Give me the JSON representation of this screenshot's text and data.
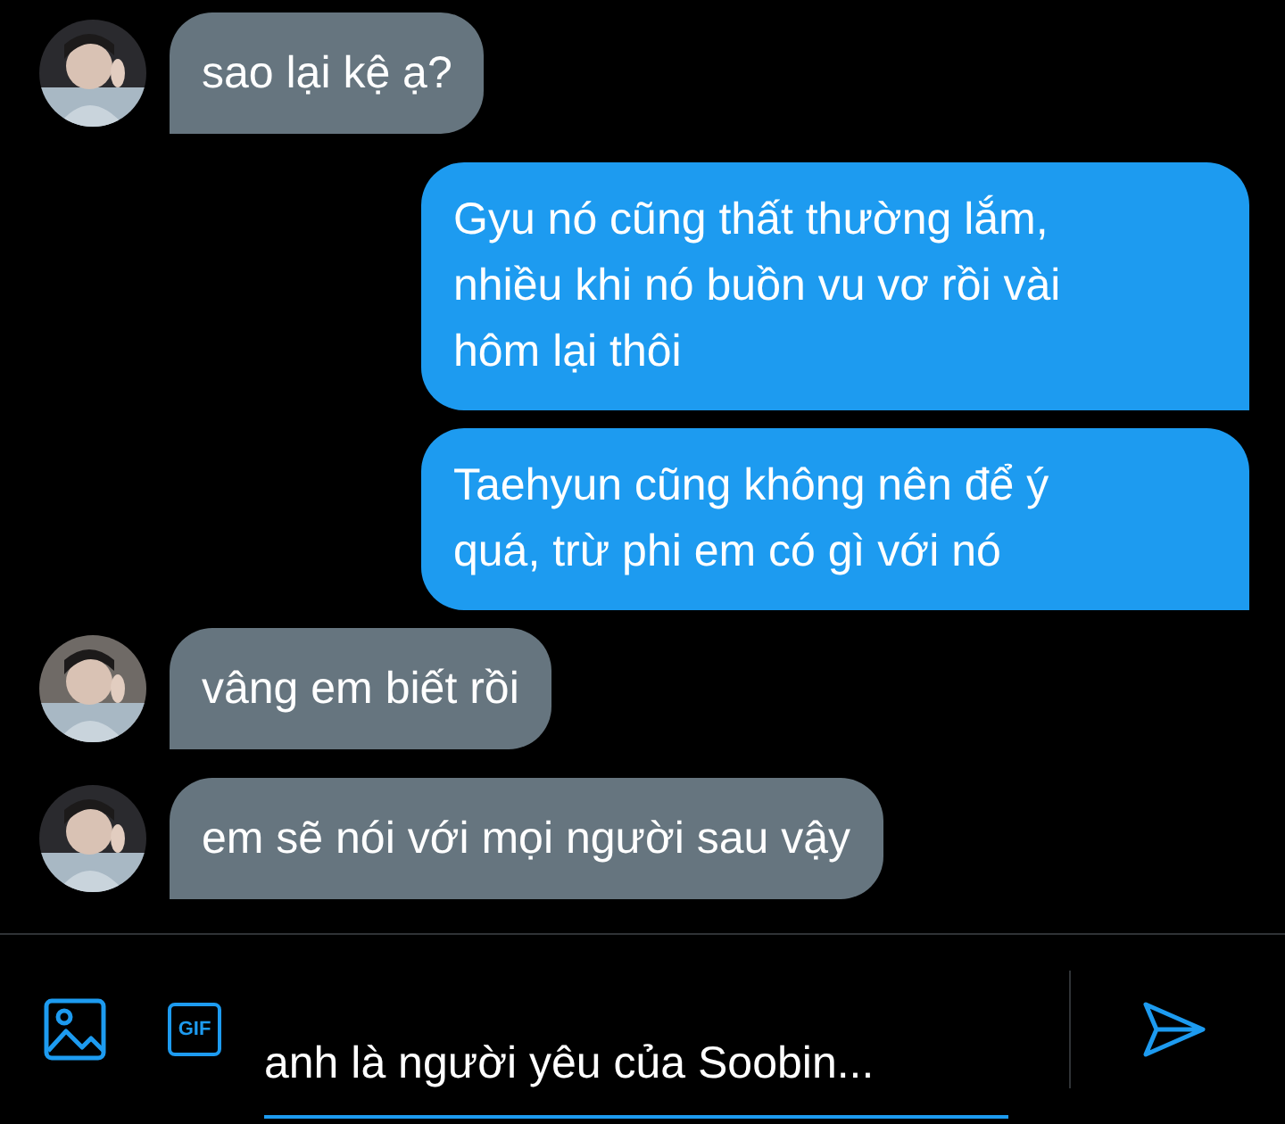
{
  "messages": [
    {
      "kind": "received",
      "text": "sao lại kệ ạ?"
    },
    {
      "kind": "sent",
      "text": "Gyu nó cũng thất thường lắm, nhiều khi nó buồn vu vơ rồi vài hôm lại thôi"
    },
    {
      "kind": "sent",
      "text": "Taehyun cũng không nên để ý quá, trừ phi em có gì với nó"
    },
    {
      "kind": "received",
      "text": "vâng em biết rồi"
    },
    {
      "kind": "received",
      "text": "em sẽ nói với mọi người sau vậy"
    }
  ],
  "composer": {
    "gif_label": "GIF",
    "value": "anh là người yêu của Soobin..."
  }
}
